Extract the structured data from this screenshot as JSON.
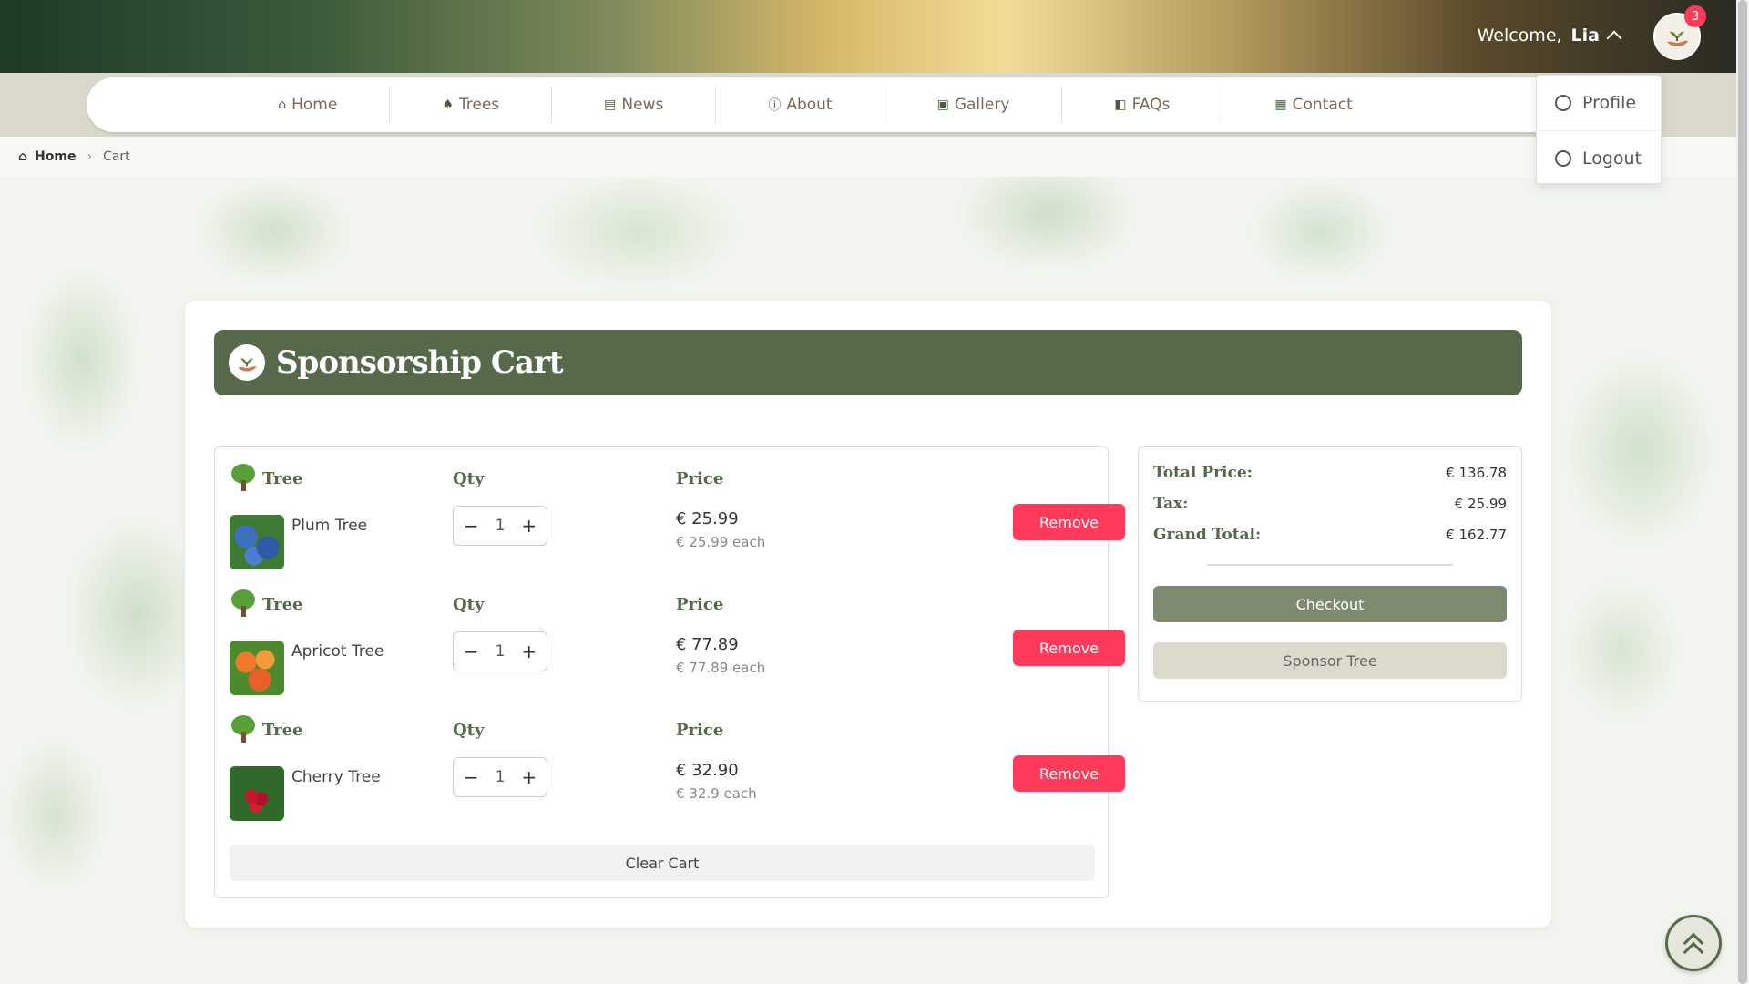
{
  "header": {
    "welcome_prefix": "Welcome,",
    "user_name": "Lia",
    "cart_count": "3"
  },
  "nav": {
    "items": [
      {
        "label": "Home",
        "icon": "⌂"
      },
      {
        "label": "Trees",
        "icon": "♠"
      },
      {
        "label": "News",
        "icon": "▤"
      },
      {
        "label": "About",
        "icon": "ⓘ"
      },
      {
        "label": "Gallery",
        "icon": "▣"
      },
      {
        "label": "FAQs",
        "icon": "◧"
      },
      {
        "label": "Contact",
        "icon": "▦"
      }
    ]
  },
  "dropdown": {
    "profile": "Profile",
    "logout": "Logout"
  },
  "breadcrumb": {
    "home": "Home",
    "current": "Cart"
  },
  "cart": {
    "title": "Sponsorship Cart",
    "col_tree": "Tree",
    "col_qty": "Qty",
    "col_price": "Price",
    "remove_label": "Remove",
    "clear_label": "Clear Cart",
    "items": [
      {
        "name": "Plum Tree",
        "qty": "1",
        "price": "€ 25.99",
        "each": "€ 25.99 each"
      },
      {
        "name": "Apricot Tree",
        "qty": "1",
        "price": "€ 77.89",
        "each": "€ 77.89 each"
      },
      {
        "name": "Cherry Tree",
        "qty": "1",
        "price": "€ 32.90",
        "each": "€ 32.9 each"
      }
    ]
  },
  "summary": {
    "total_label": "Total Price:",
    "total_value": "€ 136.78",
    "tax_label": "Tax:",
    "tax_value": "€ 25.99",
    "grand_label": "Grand Total:",
    "grand_value": "€ 162.77",
    "checkout_label": "Checkout",
    "sponsor_label": "Sponsor Tree"
  },
  "colors": {
    "brand_green": "#566a4b",
    "danger": "#ff3b5c",
    "accent_beige": "#dad7cb"
  }
}
